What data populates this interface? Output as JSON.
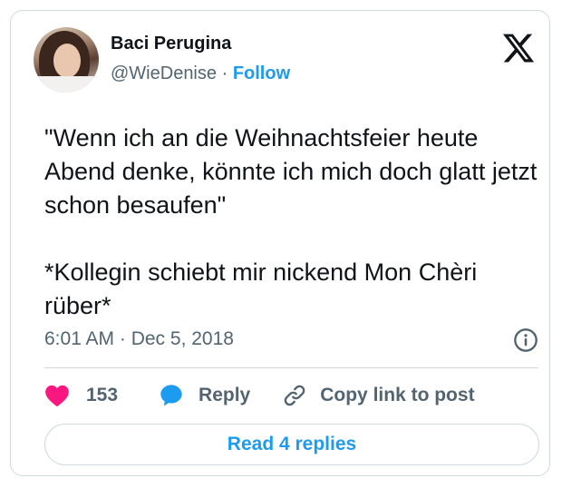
{
  "author": {
    "name": "Baci Perugina",
    "handle": "@WieDenise",
    "separator": "·",
    "follow_label": "Follow"
  },
  "tweet": {
    "paragraphs": [
      "\"Wenn ich an die Weihnachtsfeier heute Abend denke, könnte ich mich doch glatt jetzt schon besaufen\"",
      "*Kollegin schiebt mir nickend Mon Chèri rüber*"
    ],
    "timestamp": "6:01 AM · Dec 5, 2018"
  },
  "actions": {
    "like_count": "153",
    "reply_label": "Reply",
    "copy_label": "Copy link to post"
  },
  "read_replies_label": "Read 4 replies",
  "icons": {
    "brand": "x-logo-icon",
    "like": "heart-icon",
    "reply": "speech-bubble-icon",
    "copy": "link-icon",
    "info": "info-icon"
  },
  "colors": {
    "accent": "#1d9bf0",
    "like": "#f91880",
    "text": "#0f1419",
    "secondary": "#536471",
    "border": "#cfd9de"
  }
}
